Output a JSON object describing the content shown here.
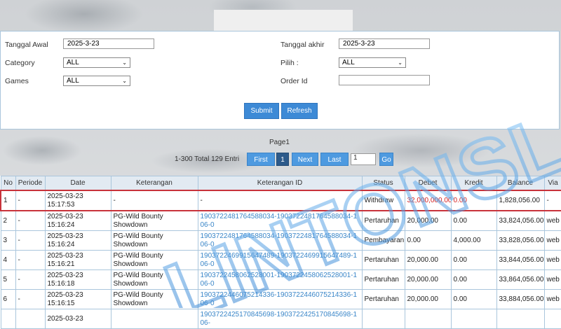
{
  "filters": {
    "start_date_label": "Tanggal Awal",
    "start_date_value": "2025-3-23",
    "end_date_label": "Tanggal akhir",
    "end_date_value": "2025-3-23",
    "category_label": "Category",
    "category_value": "ALL",
    "pilih_label": "Pilih  :",
    "pilih_value": "ALL",
    "games_label": "Games",
    "games_value": "ALL",
    "order_id_label": "Order Id",
    "order_id_value": ""
  },
  "actions": {
    "submit_label": "Submit",
    "refresh_label": "Refresh"
  },
  "pagination": {
    "page_label": "Page1",
    "info": "1-300 Total 129 Entri",
    "first_label": "First",
    "current_label": "1",
    "next_label": "Next",
    "last_label": "Last",
    "page_input_value": "1",
    "go_label": "Go"
  },
  "table": {
    "headers": [
      "No",
      "Periode",
      "Date",
      "Keterangan",
      "Keterangan ID",
      "Status",
      "Debet",
      "Kredit",
      "Balance",
      "Via"
    ],
    "rows": [
      {
        "no": "1",
        "periode": "-",
        "date": "2025-03-23 15:17:53",
        "ket": "-",
        "ket_id": "-",
        "status": "Withdraw",
        "debet": "32,000,000.00",
        "kredit": "0.00",
        "balance": "1,828,056.00",
        "via": "-"
      },
      {
        "no": "2",
        "periode": "-",
        "date": "2025-03-23 15:16:24",
        "ket": "PG-Wild Bounty Showdown",
        "ket_id": "1903722481764588034-1903722481764588034-106-0",
        "status": "Pertaruhan",
        "debet": "20,000.00",
        "kredit": "0.00",
        "balance": "33,824,056.00",
        "via": "web"
      },
      {
        "no": "3",
        "periode": "-",
        "date": "2025-03-23 15:16:24",
        "ket": "PG-Wild Bounty Showdown",
        "ket_id": "1903722481764588034-1903722481764588034-106-0",
        "status": "Pembayaran",
        "debet": "0.00",
        "kredit": "4,000.00",
        "balance": "33,828,056.00",
        "via": "web"
      },
      {
        "no": "4",
        "periode": "-",
        "date": "2025-03-23 15:16:21",
        "ket": "PG-Wild Bounty Showdown",
        "ket_id": "1903722469915647489-1903722469915647489-106-0",
        "status": "Pertaruhan",
        "debet": "20,000.00",
        "kredit": "0.00",
        "balance": "33,844,056.00",
        "via": "web"
      },
      {
        "no": "5",
        "periode": "-",
        "date": "2025-03-23 15:16:18",
        "ket": "PG-Wild Bounty Showdown",
        "ket_id": "1903722458062528001-1903722458062528001-106-0",
        "status": "Pertaruhan",
        "debet": "20,000.00",
        "kredit": "0.00",
        "balance": "33,864,056.00",
        "via": "web"
      },
      {
        "no": "6",
        "periode": "-",
        "date": "2025-03-23 15:16:15",
        "ket": "PG-Wild Bounty Showdown",
        "ket_id": "1903722446075214336-1903722446075214336-106-0",
        "status": "Pertaruhan",
        "debet": "20,000.00",
        "kredit": "0.00",
        "balance": "33,884,056.00",
        "via": "web"
      },
      {
        "no": "",
        "periode": "",
        "date": "2025-03-23",
        "ket": "",
        "ket_id": "1903722425170845698-1903722425170845698-106-",
        "status": "",
        "debet": "",
        "kredit": "",
        "balance": "",
        "via": ""
      }
    ]
  },
  "watermark_text": "LINTONSLOT",
  "colors": {
    "accent": "#3d8ad6",
    "link": "#3a86c8",
    "highlight": "#c8333b",
    "debit_red": "#d42020"
  }
}
